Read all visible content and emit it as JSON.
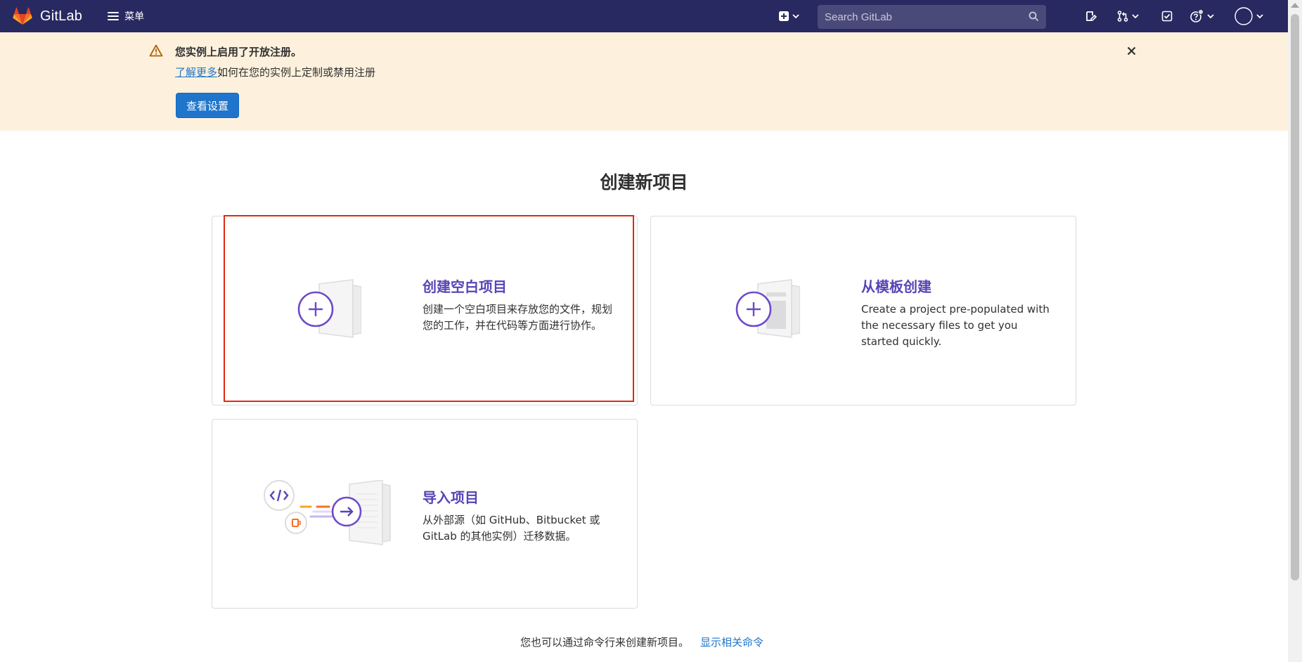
{
  "navbar": {
    "brand_name": "GitLab",
    "menu_label": "菜单",
    "search_placeholder": "Search GitLab",
    "colors": {
      "background": "#292961",
      "search_bg": "#4a4a7a"
    },
    "icons": [
      "plus-square-icon",
      "search-icon",
      "issues-icon",
      "merge-request-icon",
      "todo-icon",
      "help-icon",
      "avatar-icon"
    ]
  },
  "alert": {
    "title": "您实例上启用了开放注册。",
    "link_text": "了解更多",
    "body_text": "如何在您的实例上定制或禁用注册",
    "button_label": "查看设置",
    "colors": {
      "background": "#fdf1dd",
      "button": "#1f75cb"
    }
  },
  "page": {
    "title": "创建新项目"
  },
  "cards": {
    "blank": {
      "title": "创建空白项目",
      "description": "创建一个空白项目来存放您的文件，规划您的工作，并在代码等方面进行协作。",
      "highlighted": true
    },
    "template": {
      "title": "从模板创建",
      "description": "Create a project pre-populated with the necessary files to get you started quickly."
    },
    "import": {
      "title": "导入项目",
      "description": "从外部源（如 GitHub、Bitbucket 或 GitLab 的其他实例）迁移数据。"
    },
    "accent_color": "#5943b6",
    "highlight_color": "#dd2b0e"
  },
  "footer": {
    "text": "您也可以通过命令行来创建新项目。",
    "link_text": "显示相关命令"
  }
}
